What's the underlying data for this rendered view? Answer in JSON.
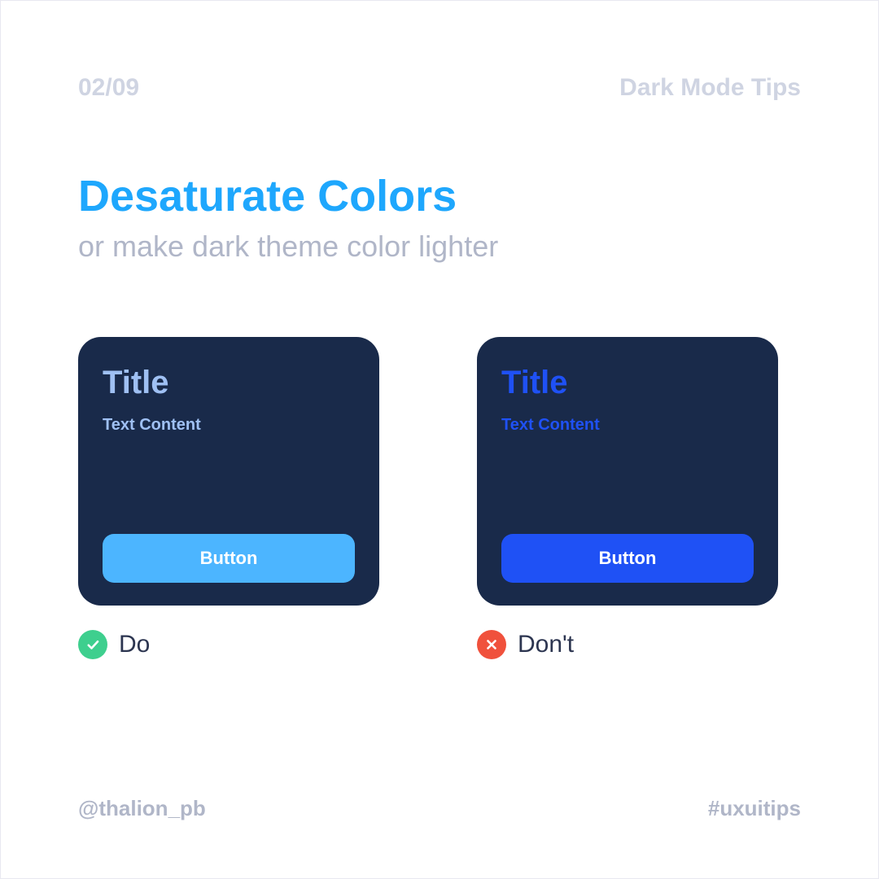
{
  "header": {
    "page_count": "02/09",
    "series_title": "Dark Mode Tips"
  },
  "heading": {
    "main": "Desaturate Colors",
    "sub": "or make dark theme color lighter"
  },
  "cards": {
    "do": {
      "title": "Title",
      "text": "Text Content",
      "button": "Button",
      "label": "Do"
    },
    "dont": {
      "title": "Title",
      "text": "Text Content",
      "button": "Button",
      "label": "Don't"
    }
  },
  "footer": {
    "handle": "@thalion_pb",
    "hashtag": "#uxuitips"
  },
  "colors": {
    "accent_blue": "#1ea7fd",
    "muted_gray": "#b0b6c8",
    "light_gray": "#cfd4e2",
    "card_bg": "#192a4a",
    "do_text": "#9fc0f3",
    "do_button": "#4cb5ff",
    "dont_blue": "#1f51f5",
    "badge_green": "#3ecf8e",
    "badge_red": "#f0513c"
  }
}
